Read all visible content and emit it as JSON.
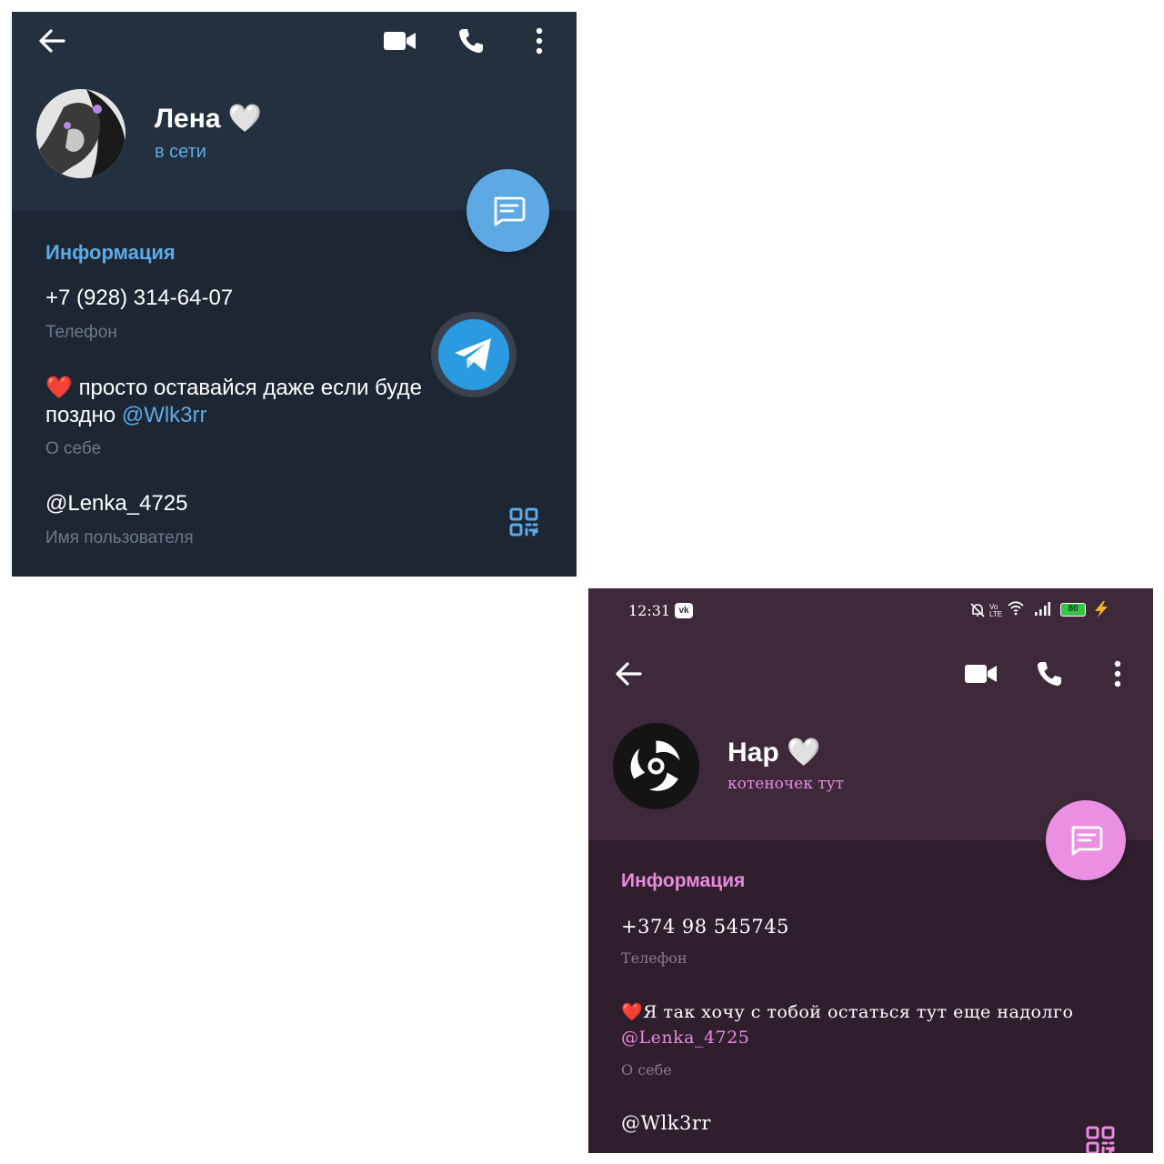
{
  "panel1": {
    "contact_name": "Лена",
    "status": "в сети",
    "section_title": "Информация",
    "phone": "+7 (928) 314-64-07",
    "phone_label": "Телефон",
    "bio_text_line1": "просто оставайся даже если буде",
    "bio_text_line2": "поздно",
    "bio_mention": "@Wlk3rr",
    "bio_label": "О себе",
    "username": "@Lenka_4725",
    "username_label": "Имя пользователя",
    "colors": {
      "background": "#1d2733",
      "header": "#233040",
      "accent": "#5eaae6"
    }
  },
  "panel2": {
    "status_bar": {
      "time": "12:31",
      "battery": "80"
    },
    "contact_name": "Нар",
    "status": "котеночек тут",
    "section_title": "Информация",
    "phone": "+374 98 545745",
    "phone_label": "Телефон",
    "bio_text": "Я так хочу с тобой остаться тут еще надолго",
    "bio_mention": "@Lenka_4725",
    "bio_label": "О себе",
    "username": "@Wlk3rr",
    "colors": {
      "background": "#2f1f2d",
      "header": "#3d2939",
      "accent": "#e98ae0"
    }
  }
}
